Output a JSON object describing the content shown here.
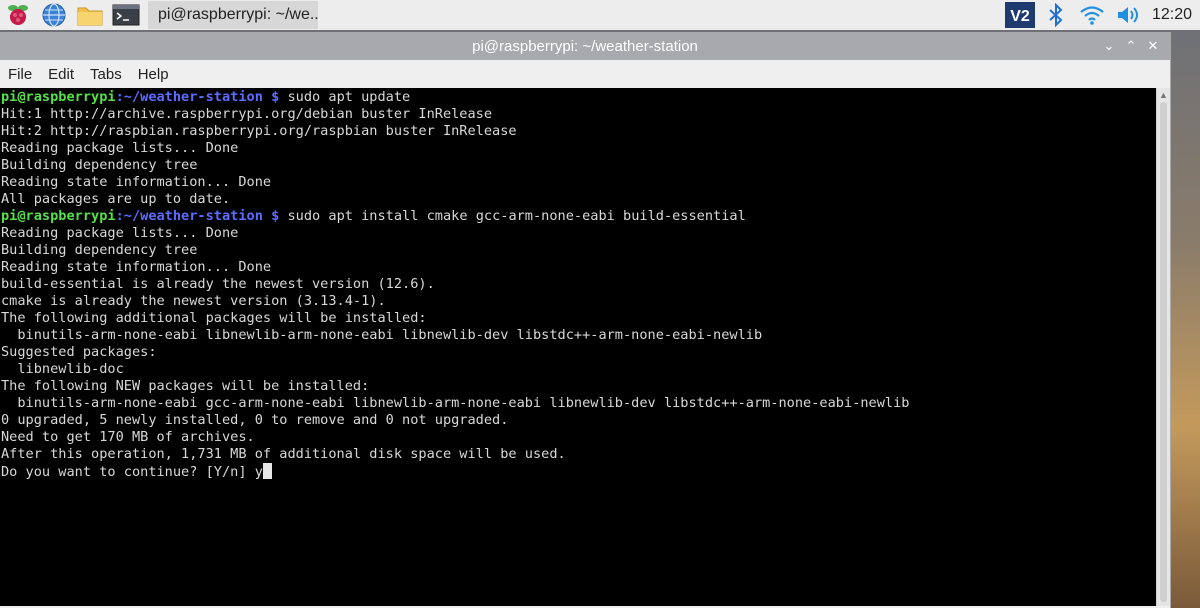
{
  "taskbar": {
    "launchers": [
      "raspberry-menu",
      "web-browser",
      "file-manager",
      "terminal"
    ],
    "task_label": "pi@raspberrypi: ~/we...",
    "tray_icons": [
      "vnc-icon",
      "bluetooth-icon",
      "wifi-icon",
      "volume-icon"
    ],
    "vnc_label": "V2",
    "clock": "12:20"
  },
  "window": {
    "title": "pi@raspberrypi: ~/weather-station",
    "controls": [
      "v",
      "^",
      "x"
    ]
  },
  "menu": {
    "file": "File",
    "edit": "Edit",
    "tabs": "Tabs",
    "help": "Help"
  },
  "prompt": {
    "user_host": "pi@raspberrypi",
    "path": ":~/weather-station",
    "sep": " $ "
  },
  "terminal": {
    "lines": [
      {
        "prompt": true,
        "cmd": "sudo apt update"
      },
      {
        "text": "Hit:1 http://archive.raspberrypi.org/debian buster InRelease"
      },
      {
        "text": "Hit:2 http://raspbian.raspberrypi.org/raspbian buster InRelease"
      },
      {
        "text": "Reading package lists... Done"
      },
      {
        "text": "Building dependency tree"
      },
      {
        "text": "Reading state information... Done"
      },
      {
        "text": "All packages are up to date."
      },
      {
        "prompt": true,
        "cmd": "sudo apt install cmake gcc-arm-none-eabi build-essential"
      },
      {
        "text": "Reading package lists... Done"
      },
      {
        "text": "Building dependency tree"
      },
      {
        "text": "Reading state information... Done"
      },
      {
        "text": "build-essential is already the newest version (12.6)."
      },
      {
        "text": "cmake is already the newest version (3.13.4-1)."
      },
      {
        "text": "The following additional packages will be installed:"
      },
      {
        "text": "  binutils-arm-none-eabi libnewlib-arm-none-eabi libnewlib-dev libstdc++-arm-none-eabi-newlib"
      },
      {
        "text": "Suggested packages:"
      },
      {
        "text": "  libnewlib-doc"
      },
      {
        "text": "The following NEW packages will be installed:"
      },
      {
        "text": "  binutils-arm-none-eabi gcc-arm-none-eabi libnewlib-arm-none-eabi libnewlib-dev libstdc++-arm-none-eabi-newlib"
      },
      {
        "text": "0 upgraded, 5 newly installed, 0 to remove and 0 not upgraded."
      },
      {
        "text": "Need to get 170 MB of archives."
      },
      {
        "text": "After this operation, 1,731 MB of additional disk space will be used."
      },
      {
        "text": "Do you want to continue? [Y/n] y",
        "cursor": true
      }
    ]
  },
  "colors": {
    "prompt_user": "#55e04a",
    "prompt_path": "#5b6cff",
    "terminal_bg": "#000000",
    "text": "#d8d8d8"
  }
}
